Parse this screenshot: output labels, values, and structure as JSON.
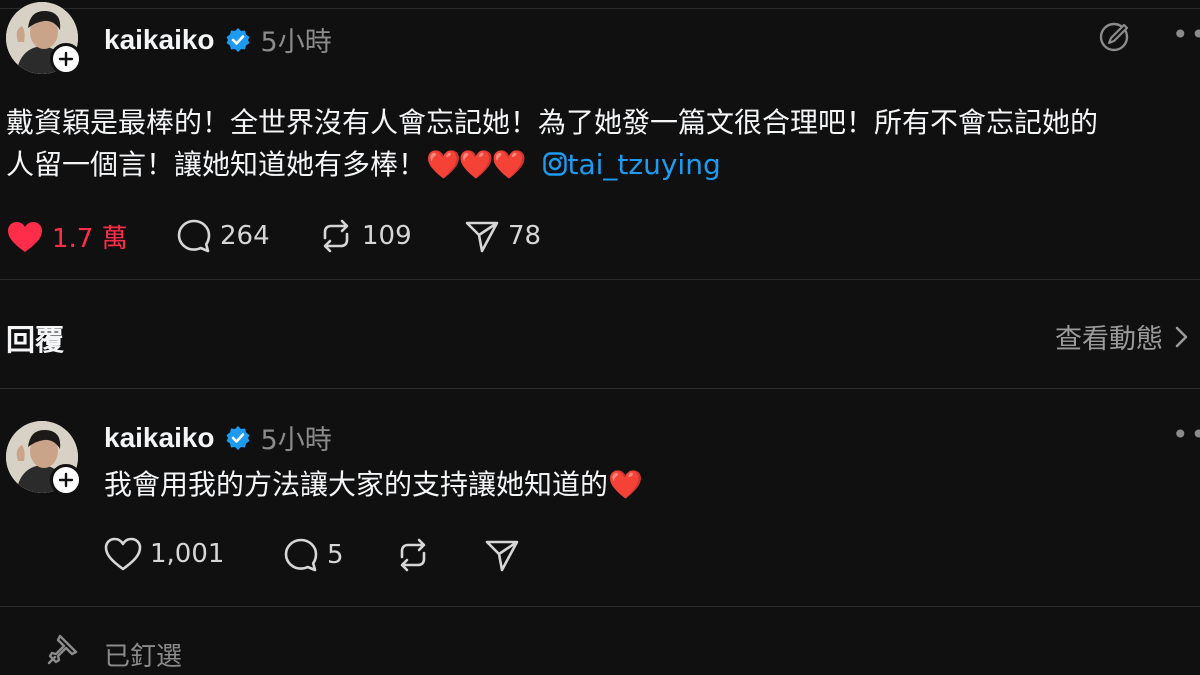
{
  "post": {
    "username": "kaikaiko",
    "time": "5小時",
    "text_line1": "戴資穎是最棒的！全世界沒有人會忘記她！為了她發一篇文很合理吧！所有不會忘記她的",
    "text_line2": "人留一個言！讓她知道她有多棒！",
    "hearts": "❤️❤️❤️",
    "mention": "tai_tzuying",
    "likes": "1.7 萬",
    "replies": "264",
    "reposts": "109",
    "shares": "78"
  },
  "replies_section": {
    "title": "回覆",
    "activity_label": "查看動態"
  },
  "reply": {
    "username": "kaikaiko",
    "time": "5小時",
    "text": "我會用我的方法讓大家的支持讓她知道的",
    "heart": "❤️",
    "likes": "1,001",
    "replies": "5"
  },
  "pinned_label": "已釘選",
  "icons": {
    "verified": "verified-badge-icon",
    "edit": "edit-circle-icon",
    "more": "more-dots-icon",
    "like": "heart-icon",
    "reply": "comment-icon",
    "repost": "repost-icon",
    "share": "send-icon",
    "chevron": "chevron-right-icon",
    "pin": "pin-icon",
    "follow": "plus-icon"
  },
  "colors": {
    "background": "#101010",
    "like_active": "#ff2d4a",
    "mention": "#1d9bf0",
    "verified": "#1d9bf0",
    "muted": "#8b8b8b"
  }
}
